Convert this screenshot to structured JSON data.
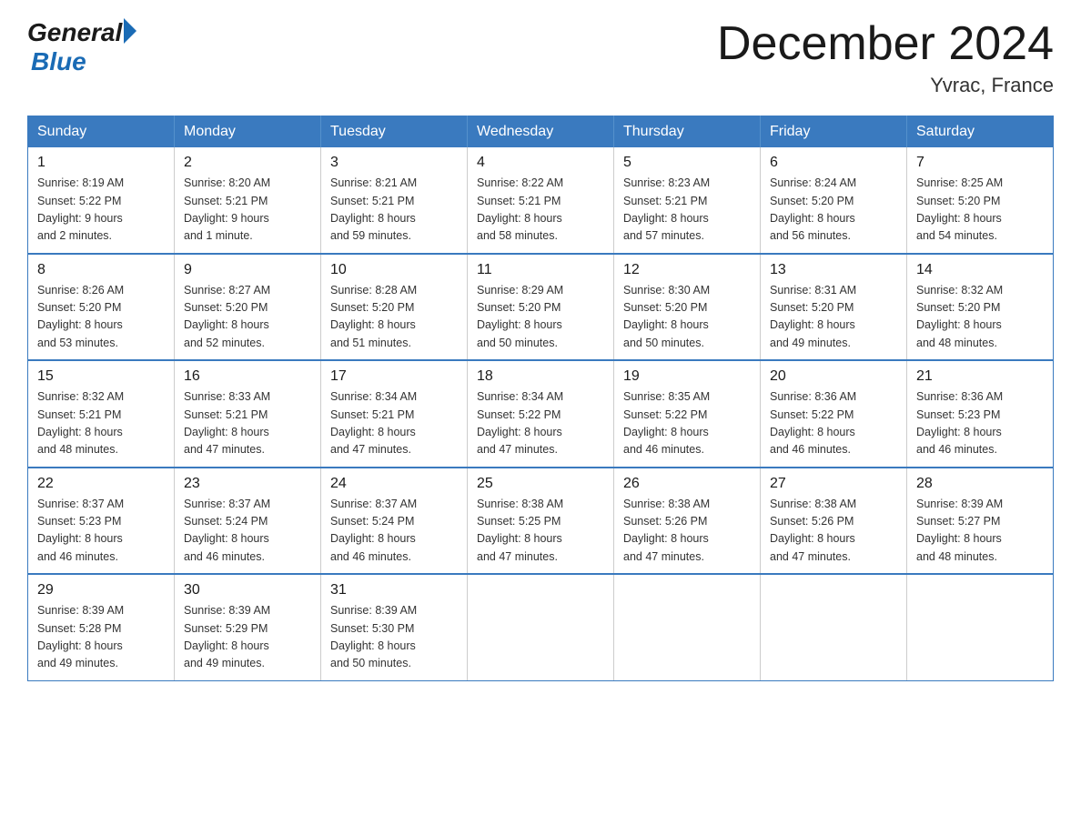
{
  "header": {
    "logo_general": "General",
    "logo_blue": "Blue",
    "title": "December 2024",
    "subtitle": "Yvrac, France"
  },
  "weekdays": [
    "Sunday",
    "Monday",
    "Tuesday",
    "Wednesday",
    "Thursday",
    "Friday",
    "Saturday"
  ],
  "weeks": [
    [
      {
        "day": "1",
        "sunrise": "8:19 AM",
        "sunset": "5:22 PM",
        "daylight": "9 hours and 2 minutes."
      },
      {
        "day": "2",
        "sunrise": "8:20 AM",
        "sunset": "5:21 PM",
        "daylight": "9 hours and 1 minute."
      },
      {
        "day": "3",
        "sunrise": "8:21 AM",
        "sunset": "5:21 PM",
        "daylight": "8 hours and 59 minutes."
      },
      {
        "day": "4",
        "sunrise": "8:22 AM",
        "sunset": "5:21 PM",
        "daylight": "8 hours and 58 minutes."
      },
      {
        "day": "5",
        "sunrise": "8:23 AM",
        "sunset": "5:21 PM",
        "daylight": "8 hours and 57 minutes."
      },
      {
        "day": "6",
        "sunrise": "8:24 AM",
        "sunset": "5:20 PM",
        "daylight": "8 hours and 56 minutes."
      },
      {
        "day": "7",
        "sunrise": "8:25 AM",
        "sunset": "5:20 PM",
        "daylight": "8 hours and 54 minutes."
      }
    ],
    [
      {
        "day": "8",
        "sunrise": "8:26 AM",
        "sunset": "5:20 PM",
        "daylight": "8 hours and 53 minutes."
      },
      {
        "day": "9",
        "sunrise": "8:27 AM",
        "sunset": "5:20 PM",
        "daylight": "8 hours and 52 minutes."
      },
      {
        "day": "10",
        "sunrise": "8:28 AM",
        "sunset": "5:20 PM",
        "daylight": "8 hours and 51 minutes."
      },
      {
        "day": "11",
        "sunrise": "8:29 AM",
        "sunset": "5:20 PM",
        "daylight": "8 hours and 50 minutes."
      },
      {
        "day": "12",
        "sunrise": "8:30 AM",
        "sunset": "5:20 PM",
        "daylight": "8 hours and 50 minutes."
      },
      {
        "day": "13",
        "sunrise": "8:31 AM",
        "sunset": "5:20 PM",
        "daylight": "8 hours and 49 minutes."
      },
      {
        "day": "14",
        "sunrise": "8:32 AM",
        "sunset": "5:20 PM",
        "daylight": "8 hours and 48 minutes."
      }
    ],
    [
      {
        "day": "15",
        "sunrise": "8:32 AM",
        "sunset": "5:21 PM",
        "daylight": "8 hours and 48 minutes."
      },
      {
        "day": "16",
        "sunrise": "8:33 AM",
        "sunset": "5:21 PM",
        "daylight": "8 hours and 47 minutes."
      },
      {
        "day": "17",
        "sunrise": "8:34 AM",
        "sunset": "5:21 PM",
        "daylight": "8 hours and 47 minutes."
      },
      {
        "day": "18",
        "sunrise": "8:34 AM",
        "sunset": "5:22 PM",
        "daylight": "8 hours and 47 minutes."
      },
      {
        "day": "19",
        "sunrise": "8:35 AM",
        "sunset": "5:22 PM",
        "daylight": "8 hours and 46 minutes."
      },
      {
        "day": "20",
        "sunrise": "8:36 AM",
        "sunset": "5:22 PM",
        "daylight": "8 hours and 46 minutes."
      },
      {
        "day": "21",
        "sunrise": "8:36 AM",
        "sunset": "5:23 PM",
        "daylight": "8 hours and 46 minutes."
      }
    ],
    [
      {
        "day": "22",
        "sunrise": "8:37 AM",
        "sunset": "5:23 PM",
        "daylight": "8 hours and 46 minutes."
      },
      {
        "day": "23",
        "sunrise": "8:37 AM",
        "sunset": "5:24 PM",
        "daylight": "8 hours and 46 minutes."
      },
      {
        "day": "24",
        "sunrise": "8:37 AM",
        "sunset": "5:24 PM",
        "daylight": "8 hours and 46 minutes."
      },
      {
        "day": "25",
        "sunrise": "8:38 AM",
        "sunset": "5:25 PM",
        "daylight": "8 hours and 47 minutes."
      },
      {
        "day": "26",
        "sunrise": "8:38 AM",
        "sunset": "5:26 PM",
        "daylight": "8 hours and 47 minutes."
      },
      {
        "day": "27",
        "sunrise": "8:38 AM",
        "sunset": "5:26 PM",
        "daylight": "8 hours and 47 minutes."
      },
      {
        "day": "28",
        "sunrise": "8:39 AM",
        "sunset": "5:27 PM",
        "daylight": "8 hours and 48 minutes."
      }
    ],
    [
      {
        "day": "29",
        "sunrise": "8:39 AM",
        "sunset": "5:28 PM",
        "daylight": "8 hours and 49 minutes."
      },
      {
        "day": "30",
        "sunrise": "8:39 AM",
        "sunset": "5:29 PM",
        "daylight": "8 hours and 49 minutes."
      },
      {
        "day": "31",
        "sunrise": "8:39 AM",
        "sunset": "5:30 PM",
        "daylight": "8 hours and 50 minutes."
      },
      null,
      null,
      null,
      null
    ]
  ],
  "labels": {
    "sunrise": "Sunrise:",
    "sunset": "Sunset:",
    "daylight": "Daylight:"
  }
}
